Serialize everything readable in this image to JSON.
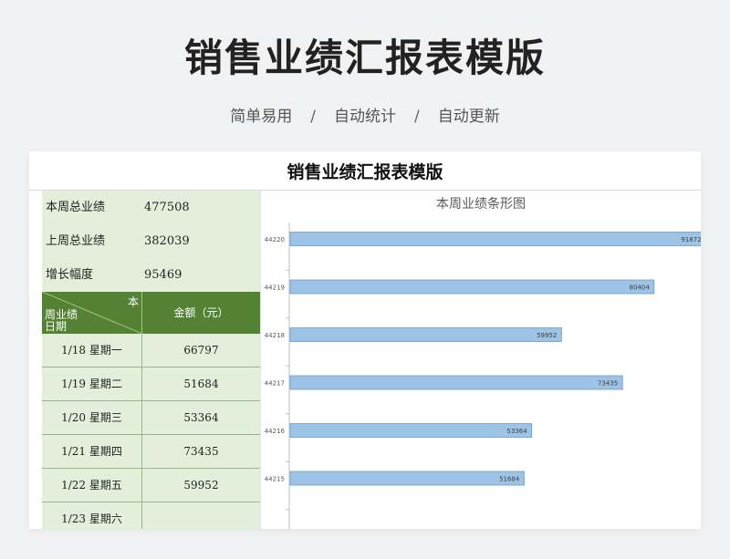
{
  "header": {
    "title": "销售业绩汇报表模版",
    "tags": [
      "简单易用",
      "自动统计",
      "自动更新"
    ],
    "separator": "/"
  },
  "sheet": {
    "title": "销售业绩汇报表模版",
    "summary": [
      {
        "label": "本周总业绩",
        "value": "477508"
      },
      {
        "label": "上周总业绩",
        "value": "382039"
      },
      {
        "label": "增长幅度",
        "value": "95469"
      }
    ],
    "table": {
      "corner_top": "本",
      "corner_mid": "周业绩",
      "corner_bottom": "日期",
      "amount_header": "金额（元）",
      "rows": [
        {
          "date": "1/18  星期一",
          "amount": "66797"
        },
        {
          "date": "1/19  星期二",
          "amount": "51684"
        },
        {
          "date": "1/20  星期三",
          "amount": "53364"
        },
        {
          "date": "1/21  星期四",
          "amount": "73435"
        },
        {
          "date": "1/22  星期五",
          "amount": "59952"
        },
        {
          "date": "1/23  星期六",
          "amount": ""
        }
      ]
    }
  },
  "colors": {
    "header_green": "#548235",
    "panel_green": "#e3efda",
    "bar_fill": "#9dc3e6",
    "bar_stroke": "#6b9ac4"
  },
  "chart_data": {
    "type": "bar",
    "orientation": "horizontal",
    "title": "本周业绩条形图",
    "categories": [
      "44220",
      "44219",
      "44218",
      "44217",
      "44216",
      "44215"
    ],
    "values": [
      91872,
      80404,
      59952,
      73435,
      53364,
      51684
    ],
    "xlim": [
      0,
      100000
    ],
    "grid": false,
    "legend": "none"
  }
}
